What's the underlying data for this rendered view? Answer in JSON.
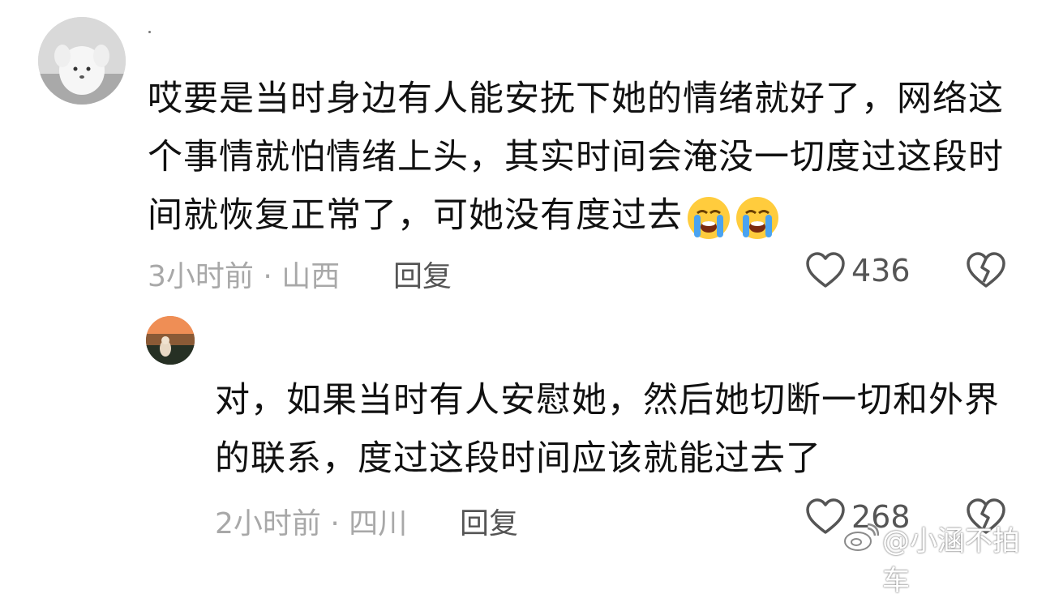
{
  "comments": [
    {
      "text": "哎要是当时身边有人能安抚下她的情绪就好了，网络这个事情就怕情绪上头，其实时间会淹没一切度过这段时间就恢复正常了，可她没有度过去",
      "emoji": "loudly-crying-face",
      "meta": "3小时前 · 山西",
      "reply_label": "回复",
      "likes": "436"
    },
    {
      "text": "对，如果当时有人安慰她，然后她切断一切和外界的联系，度过这段时间应该就能过去了",
      "meta": "2小时前 · 四川",
      "reply_label": "回复",
      "likes": "268"
    }
  ],
  "watermark": "@小涵不拍车",
  "colors": {
    "meta_gray": "#a8a8a8",
    "text": "#111111",
    "action_gray": "#555555"
  }
}
